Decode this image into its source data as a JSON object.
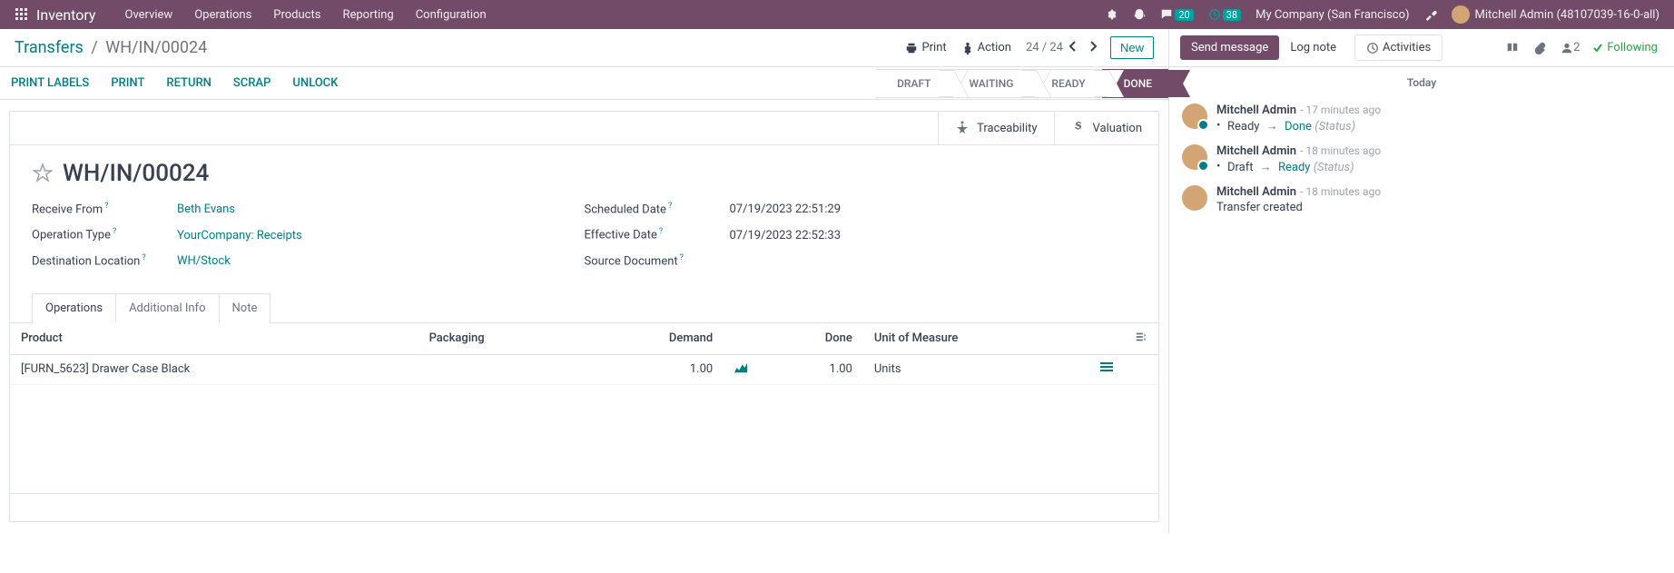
{
  "topbar": {
    "brand": "Inventory",
    "nav": [
      "Overview",
      "Operations",
      "Products",
      "Reporting",
      "Configuration"
    ],
    "messages_count": "20",
    "activities_count": "38",
    "company": "My Company (San Francisco)",
    "user": "Mitchell Admin (48107039-16-0-all)"
  },
  "breadcrumb": {
    "root": "Transfers",
    "current": "WH/IN/00024"
  },
  "controlbar": {
    "print": "Print",
    "action": "Action",
    "pager": "24 / 24",
    "new": "New"
  },
  "actions": {
    "print_labels": "PRINT LABELS",
    "print": "PRINT",
    "return": "RETURN",
    "scrap": "SCRAP",
    "unlock": "UNLOCK"
  },
  "status": {
    "draft": "DRAFT",
    "waiting": "WAITING",
    "ready": "READY",
    "done": "DONE"
  },
  "stat_buttons": {
    "traceability": "Traceability",
    "valuation": "Valuation"
  },
  "record": {
    "name": "WH/IN/00024",
    "receive_from_label": "Receive From",
    "receive_from": "Beth Evans",
    "operation_type_label": "Operation Type",
    "operation_type": "YourCompany: Receipts",
    "destination_label": "Destination Location",
    "destination": "WH/Stock",
    "scheduled_label": "Scheduled Date",
    "scheduled": "07/19/2023 22:51:29",
    "effective_label": "Effective Date",
    "effective": "07/19/2023 22:52:33",
    "source_label": "Source Document",
    "source": ""
  },
  "tabs": {
    "operations": "Operations",
    "additional": "Additional Info",
    "note": "Note"
  },
  "table": {
    "headers": {
      "product": "Product",
      "packaging": "Packaging",
      "demand": "Demand",
      "done": "Done",
      "uom": "Unit of Measure"
    },
    "rows": [
      {
        "product": "[FURN_5623] Drawer Case Black",
        "packaging": "",
        "demand": "1.00",
        "done": "1.00",
        "uom": "Units"
      }
    ]
  },
  "chatter": {
    "send": "Send message",
    "log": "Log note",
    "activities": "Activities",
    "followers": "2",
    "following": "Following",
    "today": "Today",
    "messages": [
      {
        "author": "Mitchell Admin",
        "time": "- 17 minutes ago",
        "from": "Ready",
        "to": "Done",
        "status_label": "(Status)"
      },
      {
        "author": "Mitchell Admin",
        "time": "- 18 minutes ago",
        "from": "Draft",
        "to": "Ready",
        "status_label": "(Status)"
      },
      {
        "author": "Mitchell Admin",
        "time": "- 18 minutes ago",
        "plain": "Transfer created"
      }
    ]
  }
}
